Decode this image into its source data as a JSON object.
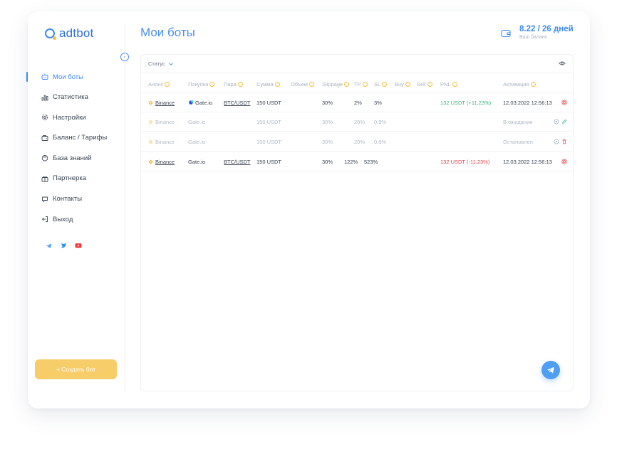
{
  "app": {
    "logo_text": "adtbot"
  },
  "page": {
    "title": "Мои боты"
  },
  "balance": {
    "value": "8.22 / 26 дней",
    "label": "Ваш баланс"
  },
  "sidebar": {
    "items": [
      {
        "label": "Мои боты",
        "icon": "robot-icon",
        "active": true
      },
      {
        "label": "Статистика",
        "icon": "bar-chart-icon"
      },
      {
        "label": "Настройки",
        "icon": "gear-icon"
      },
      {
        "label": "Баланс / Тарифы",
        "icon": "wallet-icon"
      },
      {
        "label": "База знаний",
        "icon": "book-icon"
      },
      {
        "label": "Партнерка",
        "icon": "gift-icon"
      },
      {
        "label": "Контакты",
        "icon": "chat-icon"
      },
      {
        "label": "Выход",
        "icon": "logout-icon"
      }
    ],
    "create_button": "+ Создать бот"
  },
  "table": {
    "filter_label": "Статус",
    "headers": [
      "Анонс",
      "Покупка",
      "Пара",
      "Сумма",
      "Объем",
      "Slippage",
      "TP",
      "SL",
      "Buy",
      "Sell",
      "PNL",
      "Активация"
    ],
    "rows": [
      {
        "announce": "Binance",
        "buy_exchange": "Gate.io",
        "pair": "BTC/USDT",
        "amount": "150 USDT",
        "volume": "",
        "slippage": "30%",
        "tp": "2%",
        "sl": "3%",
        "pnl": "132 USDT (+11.23%)",
        "activation": "12.03.2022 12:56:13",
        "state": "active"
      },
      {
        "announce": "Binance",
        "buy_exchange": "Gate.io",
        "pair": "",
        "amount": "150 USDT",
        "volume": "",
        "slippage": "30%",
        "tp": "20%",
        "sl": "0.9%",
        "pnl": "",
        "activation": "В ожидании",
        "state": "muted"
      },
      {
        "announce": "Binance",
        "buy_exchange": "Gate.io",
        "pair": "",
        "amount": "150 USDT",
        "volume": "",
        "slippage": "30%",
        "tp": "20%",
        "sl": "0.9%",
        "pnl": "",
        "activation": "Остановлен",
        "state": "muted"
      },
      {
        "announce": "Binance",
        "buy_exchange": "Gate.io",
        "pair": "BTC/USDT",
        "amount": "150 USDT",
        "volume": "",
        "slippage": "30%",
        "tp": "122%",
        "sl": "523%",
        "pnl": "132 USDT (-11.23%)",
        "activation": "12.03.2022 12:56:13",
        "state": "active"
      }
    ]
  },
  "colors": {
    "accent": "#3d8bf2",
    "create_button": "#f7cd6a",
    "profit": "#3fb27f",
    "loss": "#e5484d",
    "binance": "#f3ba2f"
  },
  "icons": {
    "balance": "wallet-icon",
    "visibility": "eye-icon",
    "telegram_float": "telegram-icon",
    "socials": [
      "telegram-icon",
      "twitter-icon",
      "youtube-icon"
    ]
  }
}
